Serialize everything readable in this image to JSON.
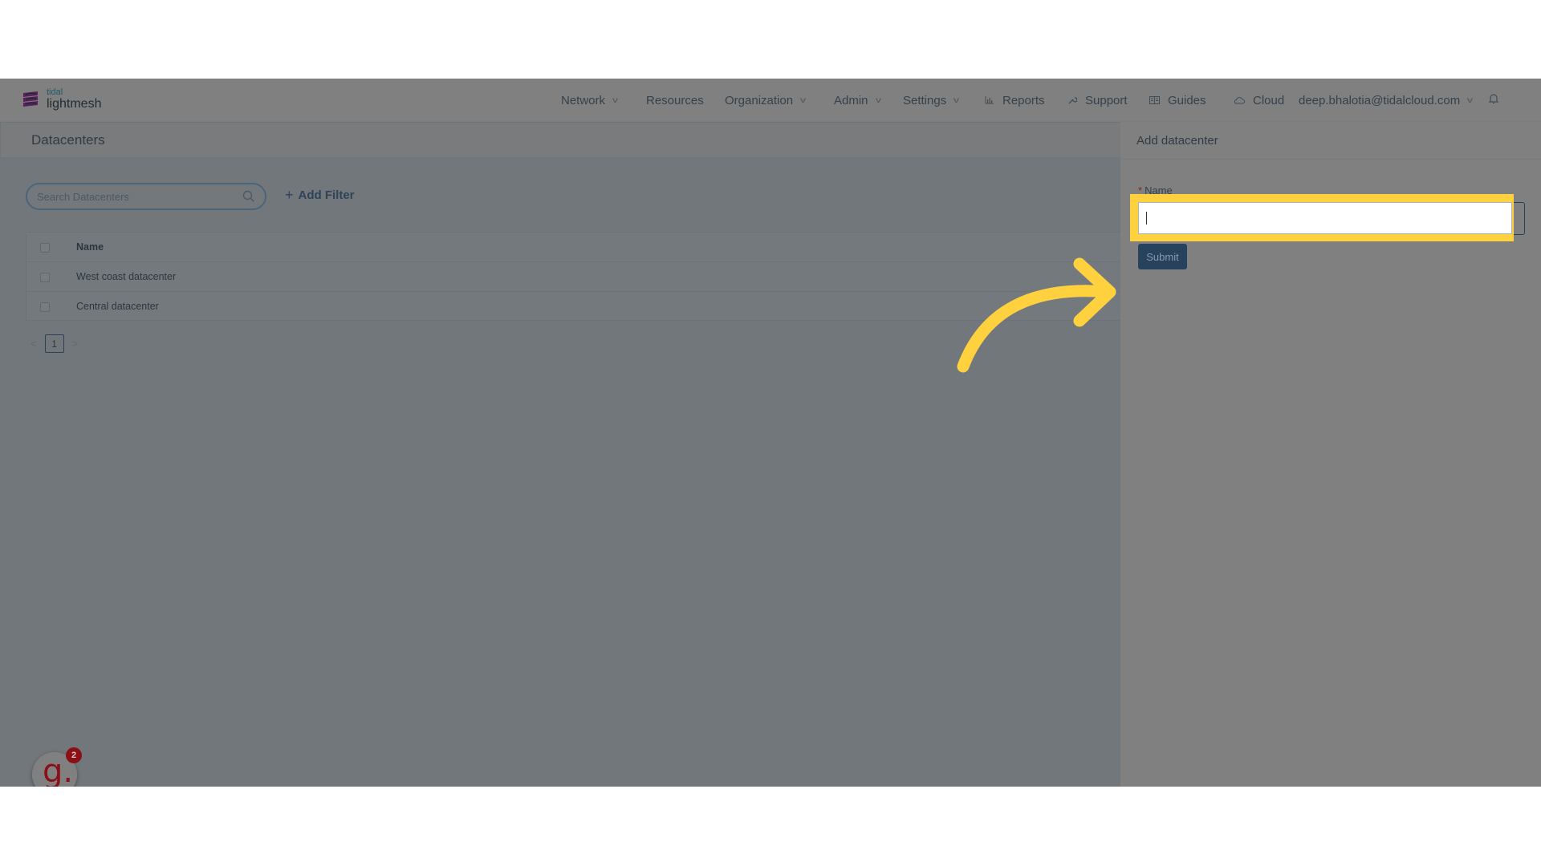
{
  "app": {
    "brand_small": "tidal",
    "brand_name": "lightmesh"
  },
  "nav": {
    "items": [
      {
        "label": "Network",
        "has_dropdown": true
      },
      {
        "label": "Resources",
        "has_dropdown": false
      },
      {
        "label": "Organization",
        "has_dropdown": true
      },
      {
        "label": "Admin",
        "has_dropdown": true
      },
      {
        "label": "Settings",
        "has_dropdown": true
      },
      {
        "label": "Reports",
        "icon": "bar-chart-icon"
      },
      {
        "label": "Support",
        "icon": "wrench-icon"
      },
      {
        "label": "Guides",
        "icon": "book-icon"
      },
      {
        "label": "Cloud",
        "icon": "cloud-icon"
      }
    ],
    "user_email": "deep.bhalotia@tidalcloud.com",
    "notifications_icon": "bell-icon"
  },
  "page": {
    "title": "Datacenters",
    "search_placeholder": "Search Datacenters",
    "add_filter_label": "Add Filter",
    "table": {
      "columns": [
        "Name"
      ],
      "rows": [
        {
          "name": "West coast datacenter"
        },
        {
          "name": "Central datacenter"
        }
      ]
    },
    "pagination": {
      "current_page": "1",
      "prev_icon": "chevron-left-icon",
      "next_icon": "chevron-right-icon"
    }
  },
  "drawer": {
    "title": "Add datacenter",
    "name_label": "Name",
    "required_marker": "*",
    "name_value": "",
    "submit_label": "Submit"
  },
  "guide_widget": {
    "letter": "g.",
    "badge_count": "2"
  },
  "colors": {
    "highlight": "#ffd13f",
    "primary_button": "#27425c",
    "required": "#8e2020",
    "guide_brand": "#8b0f16"
  }
}
